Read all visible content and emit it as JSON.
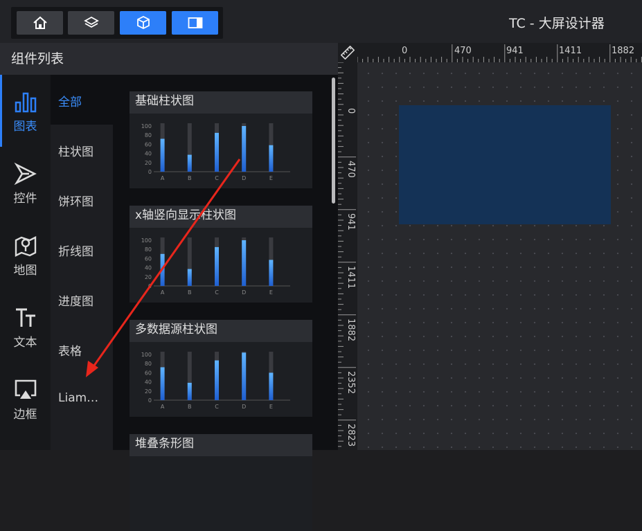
{
  "app": {
    "title": "TC - 大屏设计器"
  },
  "toolbar": {
    "buttons": [
      {
        "icon": "home-icon",
        "active": false
      },
      {
        "icon": "layers-icon",
        "active": false
      },
      {
        "icon": "cube-icon",
        "active": true
      },
      {
        "icon": "panel-toggle-icon",
        "active": true
      }
    ]
  },
  "panel": {
    "title": "组件列表"
  },
  "categories": [
    {
      "label": "图表",
      "icon": "bar-chart-icon",
      "active": true
    },
    {
      "label": "控件",
      "icon": "play-cursor-icon",
      "active": false
    },
    {
      "label": "地图",
      "icon": "map-pin-icon",
      "active": false
    },
    {
      "label": "文本",
      "icon": "text-icon",
      "active": false
    },
    {
      "label": "边框",
      "icon": "border-frame-icon",
      "active": false
    }
  ],
  "subcategories": [
    "全部",
    "柱状图",
    "饼环图",
    "折线图",
    "进度图",
    "表格",
    "Liam…"
  ],
  "components": [
    {
      "title": "基础柱状图"
    },
    {
      "title": "x轴竖向显示柱状图"
    },
    {
      "title": "多数据源柱状图"
    },
    {
      "title": "堆叠条形图"
    }
  ],
  "chart_data": [
    {
      "type": "bar",
      "categories": [
        "A",
        "B",
        "C",
        "D",
        "E"
      ],
      "values": [
        72,
        37,
        85,
        100,
        58
      ],
      "yticks": [
        "100",
        "80",
        "60",
        "40",
        "20",
        "0"
      ],
      "ylim": [
        0,
        100
      ]
    },
    {
      "type": "bar",
      "categories": [
        "A",
        "B",
        "C",
        "D",
        "E"
      ],
      "values": [
        70,
        37,
        85,
        100,
        57
      ],
      "yticks": [
        "100",
        "80",
        "60",
        "40",
        "20",
        "0"
      ],
      "ylim": [
        0,
        100
      ]
    },
    {
      "type": "bar",
      "categories": [
        "A",
        "B",
        "C",
        "D",
        "E"
      ],
      "values": [
        72,
        38,
        87,
        104,
        60
      ],
      "yticks": [
        "100",
        "80",
        "60",
        "40",
        "20",
        "0"
      ],
      "ylim": [
        0,
        100
      ]
    }
  ],
  "ruler": {
    "horizontal": [
      "0",
      "470",
      "941",
      "1411",
      "1882"
    ],
    "vertical": [
      "0",
      "470",
      "941",
      "1411",
      "1882",
      "2352",
      "2823"
    ]
  },
  "colors": {
    "accent": "#2d7ff9",
    "artboard": "#143256",
    "annotation": "#e8261c"
  }
}
